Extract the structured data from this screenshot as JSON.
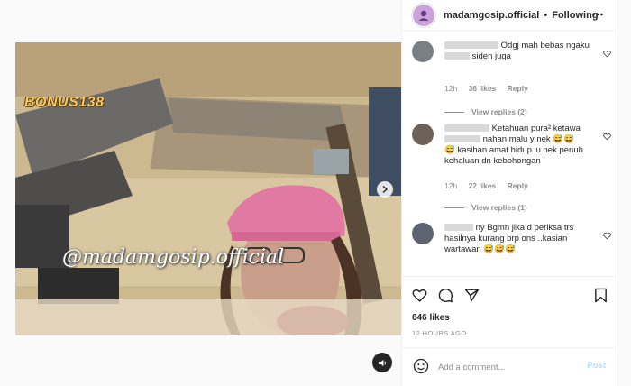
{
  "media": {
    "brand_badge": "BONUS138",
    "watermark": "@madamgosip.official",
    "carousel_next_icon": "chevron-right-icon",
    "audio_icon": "speaker-icon"
  },
  "header": {
    "username": "madamgosip.official",
    "separator": "•",
    "follow_status": "Following",
    "more_icon": "more-horizontal-icon"
  },
  "comments": [
    {
      "text_a": "Odgj mah bebas ngaku",
      "text_b": "siden juga",
      "time": "12h",
      "likes": "36 likes",
      "reply_label": "Reply",
      "view_replies": "View replies (2)"
    },
    {
      "text_a": "Ketahuan pura² ketawa",
      "text_b": "nahan malu y nek 😅😅",
      "text_c": "😅 kasihan amat hidup lu nek penuh kehaluan dn kebohongan",
      "time": "12h",
      "likes": "22 likes",
      "reply_label": "Reply",
      "view_replies": "View replies (1)"
    },
    {
      "text_a": "ny Bgmn jika d periksa trs hasilnya kurang brp ons ..kasian wartawan 😅😅😅"
    }
  ],
  "stats": {
    "likes": "646 likes",
    "time_ago": "12 HOURS AGO"
  },
  "composer": {
    "placeholder": "Add a comment...",
    "post_label": "Post",
    "emoji_icon": "emoji-icon"
  },
  "colors": {
    "accent_post_disabled": "#b2dffc",
    "text_primary": "#262626",
    "text_secondary": "#8e8e8e"
  }
}
